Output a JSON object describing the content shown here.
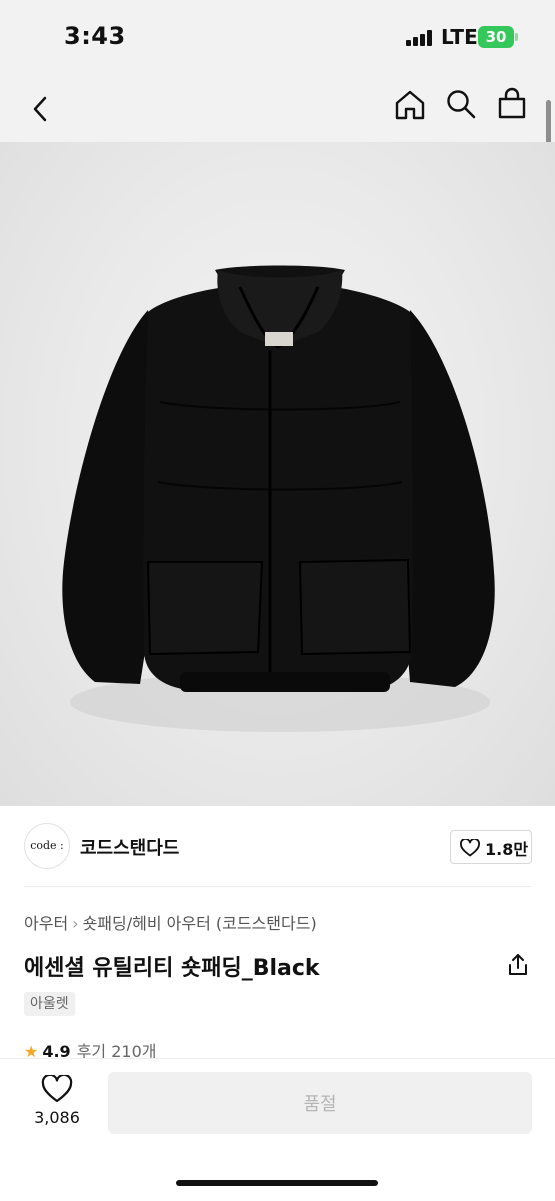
{
  "status_bar": {
    "time": "3:43",
    "network": "LTE",
    "battery": "30"
  },
  "nav": {
    "icons": [
      "back-icon",
      "home-icon",
      "search-icon",
      "shopping-bag-icon"
    ]
  },
  "product": {
    "image_description_icon": "black-puffer-jacket",
    "brand_logo_text": "code :",
    "brand_name": "코드스탠다드",
    "brand_like_count": "1.8만",
    "breadcrumb": [
      "아우터",
      "숏패딩/헤비 아우터 (코드스탠다드)"
    ],
    "title": "에센셜 유틸리티 숏패딩_Black",
    "badge": "아울렛",
    "rating": "4.9",
    "review_text": "후기 210개"
  },
  "bottom_bar": {
    "wish_count": "3,086",
    "sold_out_label": "품절"
  },
  "colors": {
    "battery": "#34c759",
    "star": "#f5a623",
    "disabled_bg": "#f0f0f0"
  }
}
